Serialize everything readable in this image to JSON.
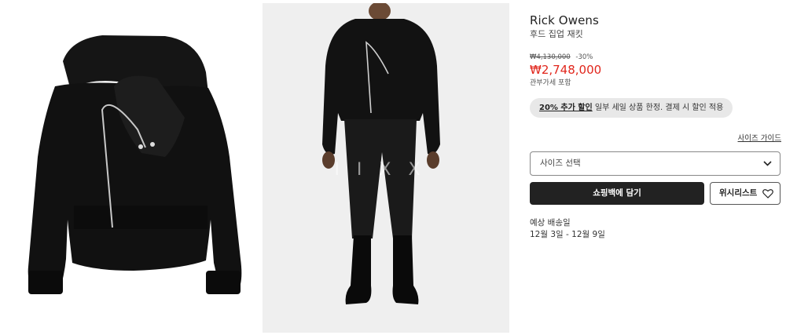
{
  "product": {
    "brand": "Rick Owens",
    "name": "후드 집업 재킷",
    "original_price": "₩4,130,000",
    "discount": "-30%",
    "price": "₩2,748,000",
    "duty_note": "관부가세 포함"
  },
  "promo": {
    "highlight": "20% 추가 할인",
    "text": " 일부 세일 상품 한정. 결제 시 할인 적용"
  },
  "size_guide_label": "사이즈 가이드",
  "size_select_placeholder": "사이즈 선택",
  "add_to_bag_label": "쇼핑백에 담기",
  "wishlist_label": "위시리스트",
  "delivery": {
    "label": "예상 배송일",
    "dates": "12월 3일 - 12월 9일"
  },
  "watermark": "IIXX",
  "colors": {
    "price_red": "#e1261c",
    "button_dark": "#222222",
    "promo_bg": "#e8e8e8"
  },
  "icons": [
    "chevron-down-icon",
    "heart-icon"
  ]
}
